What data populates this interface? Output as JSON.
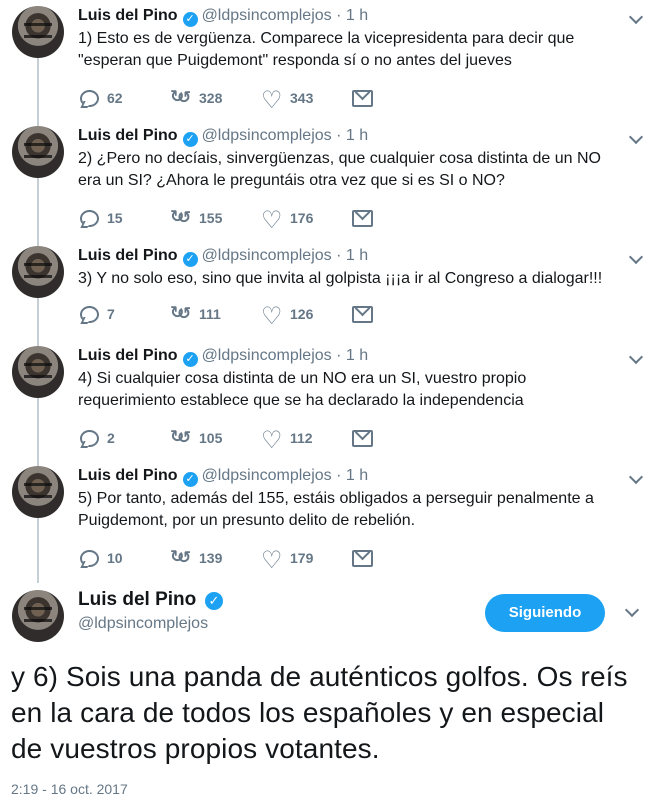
{
  "thread": [
    {
      "name": "Luis del Pino",
      "handle": "@ldpsincomplejos",
      "dot": "·",
      "time": "1 h",
      "text": "1) Esto es de vergüenza. Comparece la vicepresidenta para decir que \"esperan que Puigdemont\" responda sí o no antes del jueves",
      "replies": "62",
      "retweets": "328",
      "likes": "343"
    },
    {
      "name": "Luis del Pino",
      "handle": "@ldpsincomplejos",
      "dot": "·",
      "time": "1 h",
      "text": "2) ¿Pero no decíais, sinvergüenzas, que cualquier cosa distinta de un NO era un SI? ¿Ahora le preguntáis otra vez que si es SI o NO?",
      "replies": "15",
      "retweets": "155",
      "likes": "176"
    },
    {
      "name": "Luis del Pino",
      "handle": "@ldpsincomplejos",
      "dot": "·",
      "time": "1 h",
      "text": "3) Y no solo eso, sino que invita al golpista ¡¡¡a ir al Congreso a dialogar!!!",
      "replies": "7",
      "retweets": "111",
      "likes": "126"
    },
    {
      "name": "Luis del Pino",
      "handle": "@ldpsincomplejos",
      "dot": "·",
      "time": "1 h",
      "text": "4) Si cualquier cosa distinta de un NO era un SI, vuestro propio requerimiento establece que se ha declarado la independencia",
      "replies": "2",
      "retweets": "105",
      "likes": "112"
    },
    {
      "name": "Luis del Pino",
      "handle": "@ldpsincomplejos",
      "dot": "·",
      "time": "1 h",
      "text": "5) Por tanto, además del 155, estáis obligados a perseguir penalmente a Puigdemont, por un presunto delito de rebelión.",
      "replies": "10",
      "retweets": "139",
      "likes": "179"
    }
  ],
  "main": {
    "name": "Luis del Pino",
    "handle": "@ldpsincomplejos",
    "follow_label": "Siguiendo",
    "text": "y 6) Sois una panda de auténticos golfos. Os reís en la cara de todos los españoles y en especial de vuestros propios votantes.",
    "timestamp": "2:19 - 16 oct. 2017"
  },
  "colors": {
    "accent": "#1da1f2",
    "muted": "#657786",
    "text": "#14171a",
    "thread_line": "#c4cfd6"
  },
  "icons": {
    "verified": "verified-badge-icon",
    "reply": "reply-icon",
    "retweet": "retweet-icon",
    "like": "heart-icon",
    "message": "direct-message-icon",
    "more": "chevron-down-icon"
  }
}
